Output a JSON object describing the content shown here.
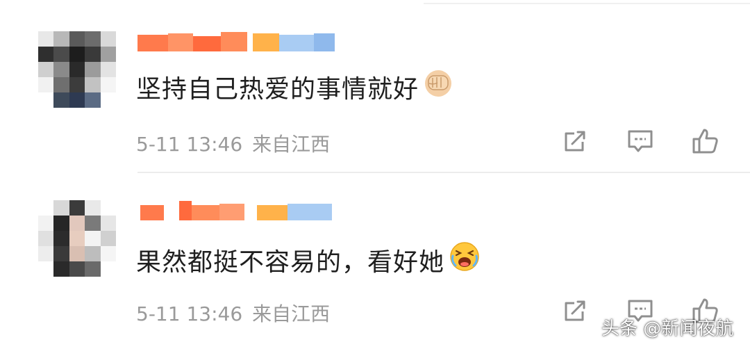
{
  "comments": [
    {
      "text": "坚持自己热爱的事情就好",
      "emoji": "fist-emoji",
      "date": "5-11 13:46",
      "location": "来自江西"
    },
    {
      "text": "果然都挺不容易的，看好她",
      "emoji": "crying-laughing-emoji",
      "date": "5-11 13:46",
      "location": "来自江西"
    }
  ],
  "icons": {
    "share": "share-icon",
    "reply": "reply-icon",
    "like": "like-icon"
  },
  "colors": {
    "text": "#1f1f1f",
    "meta": "#9a9a9a",
    "icon": "#8f8f8f",
    "blur_orange": "#ff6a3d",
    "blur_blue": "#9cc3f0"
  },
  "watermark": "头条 @新闻夜航"
}
